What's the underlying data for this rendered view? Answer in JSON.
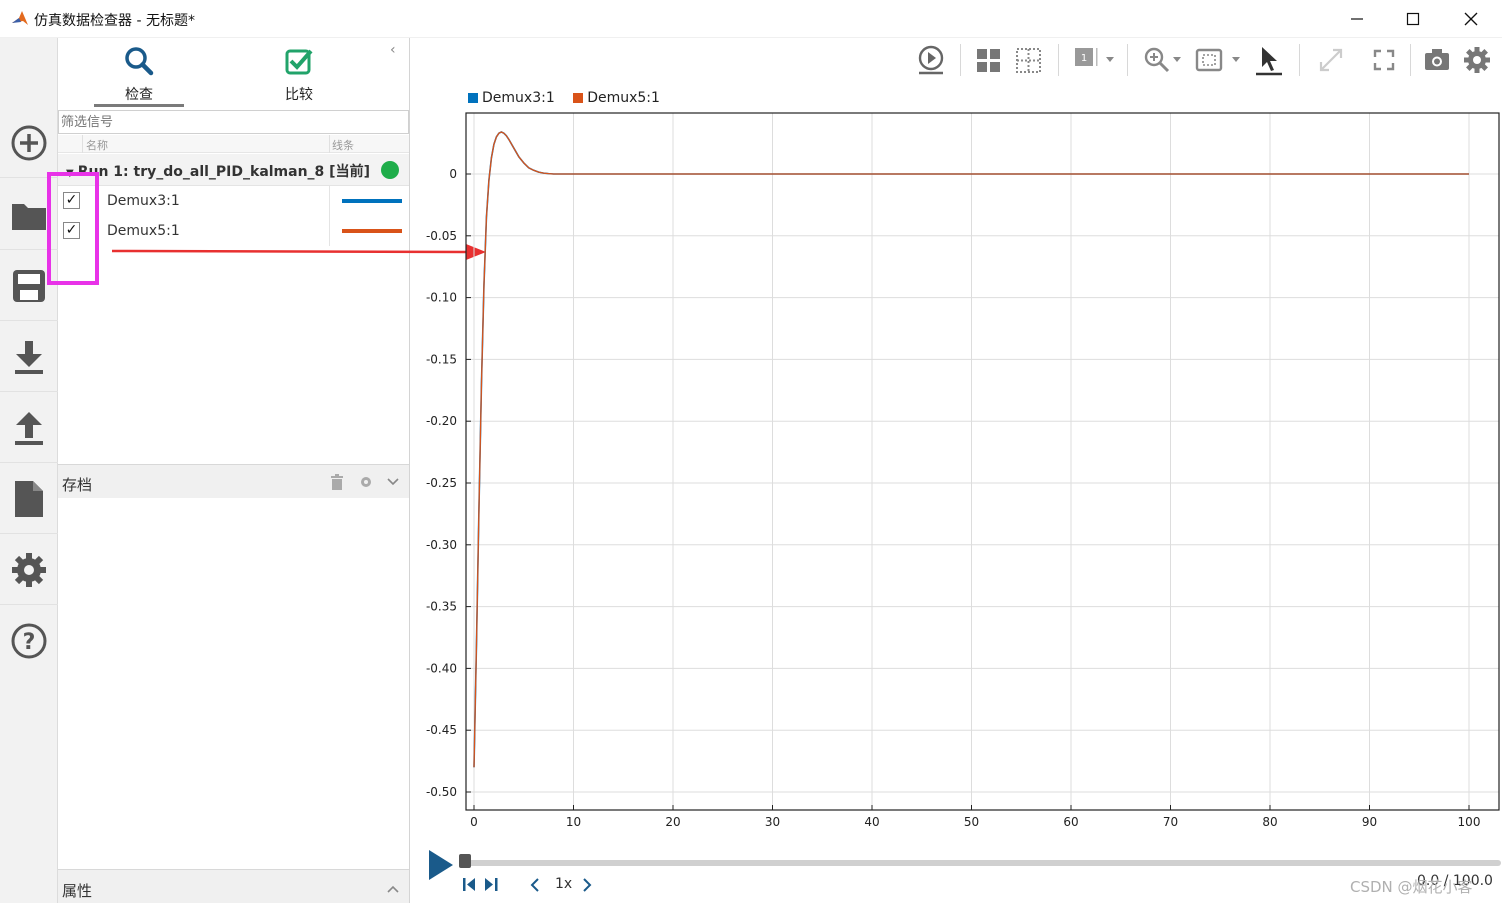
{
  "window": {
    "title": "仿真数据检查器 - 无标题*"
  },
  "tabs": {
    "inspect": "检查",
    "compare": "比较"
  },
  "signals_panel": {
    "filter_placeholder": "筛选信号",
    "columns": {
      "name": "名称",
      "line": "线条"
    },
    "run": {
      "label": "Run 1: try_do_all_PID_kalman_8 [当前]",
      "status_color": "#1fad4a"
    },
    "signals": [
      {
        "name": "Demux3:1",
        "checked": true,
        "color": "#0072bd"
      },
      {
        "name": "Demux5:1",
        "checked": true,
        "color": "#d95319"
      }
    ]
  },
  "archive": {
    "title": "存档"
  },
  "properties": {
    "title": "属性"
  },
  "legend": [
    "Demux3:1",
    "Demux5:1"
  ],
  "playback": {
    "speed": "1x",
    "time": "0.0 / 100.0",
    "progress": 0.0
  },
  "watermark": "CSDN @烟花小客",
  "chart_data": {
    "type": "line",
    "xlim": [
      0,
      100
    ],
    "ylim": [
      -0.5,
      0
    ],
    "xticks": [
      "0",
      "10",
      "20",
      "30",
      "40",
      "50",
      "60",
      "70",
      "80",
      "90",
      "100"
    ],
    "yticks": [
      "0",
      "-0.05",
      "-0.10",
      "-0.15",
      "-0.20",
      "-0.25",
      "-0.30",
      "-0.35",
      "-0.40",
      "-0.45",
      "-0.50"
    ],
    "grid": true,
    "legend_placement": "top-left",
    "series": [
      {
        "name": "Demux3:1",
        "color": "#0072bd",
        "x": [
          0,
          0.25,
          0.5,
          0.75,
          1.0,
          1.25,
          1.5,
          1.75,
          2.0,
          2.25,
          2.5,
          2.75,
          3.0,
          3.25,
          3.5,
          4.0,
          4.5,
          5.0,
          5.5,
          6.0,
          6.5,
          7.0,
          7.5,
          8.0,
          9.0,
          10.0,
          20.0,
          40.0,
          60.0,
          80.0,
          100.0
        ],
        "y": [
          -0.48,
          -0.38,
          -0.27,
          -0.17,
          -0.09,
          -0.035,
          -0.005,
          0.013,
          0.024,
          0.03,
          0.033,
          0.034,
          0.033,
          0.031,
          0.028,
          0.021,
          0.014,
          0.009,
          0.005,
          0.003,
          0.0015,
          0.0007,
          0.0003,
          0.0,
          0.0,
          0.0,
          0.0,
          0.0,
          0.0,
          0.0,
          0.0
        ]
      },
      {
        "name": "Demux5:1",
        "color": "#d95319",
        "x": [
          0,
          0.25,
          0.5,
          0.75,
          1.0,
          1.25,
          1.5,
          1.75,
          2.0,
          2.25,
          2.5,
          2.75,
          3.0,
          3.25,
          3.5,
          4.0,
          4.5,
          5.0,
          5.5,
          6.0,
          6.5,
          7.0,
          7.5,
          8.0,
          9.0,
          10.0,
          20.0,
          40.0,
          60.0,
          80.0,
          100.0
        ],
        "y": [
          -0.48,
          -0.38,
          -0.27,
          -0.17,
          -0.09,
          -0.035,
          -0.005,
          0.013,
          0.024,
          0.03,
          0.033,
          0.034,
          0.033,
          0.031,
          0.028,
          0.021,
          0.014,
          0.009,
          0.005,
          0.003,
          0.0015,
          0.0007,
          0.0003,
          0.0,
          0.0,
          0.0,
          0.0,
          0.0,
          0.0,
          0.0,
          0.0
        ]
      }
    ]
  }
}
